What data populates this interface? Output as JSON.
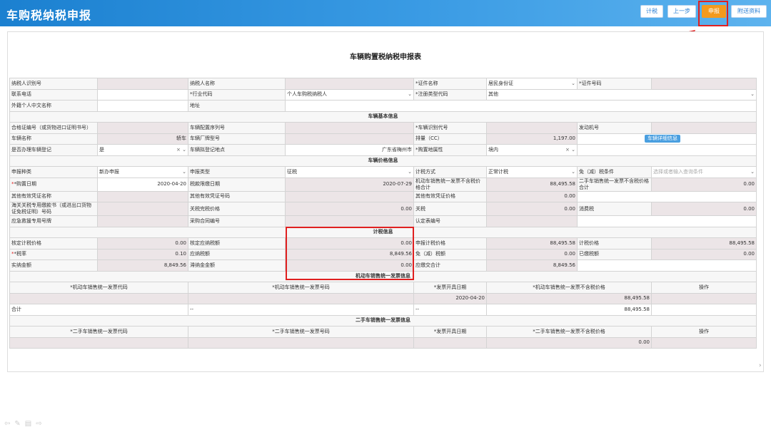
{
  "app_title": "车购税纳税申报",
  "toolbar": {
    "calc": "计税",
    "prev": "上一步",
    "submit": "申报",
    "attach": "附送资料"
  },
  "form_title": "车辆购置税纳税申报表",
  "r1": {
    "l1": "纳税人识别号",
    "l2": "纳税人名称",
    "l3": "*证件名称",
    "v3": "居民身份证",
    "l4": "*证件号码"
  },
  "r2": {
    "l1": "联系电话",
    "l2": "*行业代码",
    "v2": "个人车购税纳税人",
    "l3": "*注册类型代码",
    "v3": "其他"
  },
  "r3": {
    "l1": "外籍个人中文名称",
    "l2": "地址"
  },
  "s1": "车辆基本信息",
  "r4": {
    "l1": "合格证编号（或货物进口证明书号）",
    "l2": "车辆配置序列号",
    "l3": "*车辆识别代号",
    "l4": "发动机号"
  },
  "r5": {
    "l1": "车辆名称",
    "v1": "轿车",
    "l2": "车辆厂牌型号",
    "l3": "排量（CC）",
    "v3": "1,197.00",
    "btn": "车辆详细信息"
  },
  "r6": {
    "l1": "是否办理车辆登记",
    "v1": "是",
    "l2": "车辆拟登记地点",
    "v2": "广东省梅州市",
    "l3": "*购置地属性",
    "v3": "境内"
  },
  "s2": "车辆价格信息",
  "r7": {
    "l1": "申报种类",
    "v1": "新办申报",
    "l2": "申报类型",
    "v2": "征税",
    "l3": "计税方式",
    "v3": "正常计税",
    "l4": "免（减）税条件",
    "v4": "选择或者输入查询条件"
  },
  "r8": {
    "l1": "*购置日期",
    "v1": "2020-04-20",
    "l2": "税款限缴日期",
    "v2": "2020-07-29",
    "l3": "机动车销售统一发票不含税价格合计",
    "v3": "88,495.58",
    "l4": "二手车销售统一发票不含税价格合计",
    "v4": "0.00"
  },
  "r9": {
    "l1": "其他有效凭证名称",
    "l2": "其他有效凭证号码",
    "l3": "其他有效凭证价格",
    "v3": "0.00"
  },
  "r10": {
    "l1": "海关关税专用缴款书（或进出口货物证免税证明）号码",
    "l2": "关税完税价格",
    "v2": "0.00",
    "l3": "关税",
    "v3": "0.00",
    "l4": "消费税",
    "v4": "0.00"
  },
  "r11": {
    "l1": "应急救援专用号牌",
    "l2": "采购合同编号",
    "l3": "认定表编号"
  },
  "s3": "计税信息",
  "r12": {
    "l1": "核定计税价格",
    "v1": "0.00",
    "l2": "核定应纳税额",
    "v2": "0.00",
    "l3": "申报计税价格",
    "v3": "88,495.58",
    "l4": "计税价格",
    "v4": "88,495.58"
  },
  "r13": {
    "l1": "*税率",
    "v1": "0.10",
    "l2": "应纳税额",
    "v2": "8,849.56",
    "l3": "免（减）税额",
    "v3": "0.00",
    "l4": "已缴税额",
    "v4": "0.00"
  },
  "r14": {
    "l1": "实纳金额",
    "v1": "8,849.56",
    "l2": "滞纳金金额",
    "v2": "0.00",
    "l3": "应缴交合计",
    "v3": "8,849.56"
  },
  "s4": "机动车销售统一发票信息",
  "inv1": {
    "h1": "*机动车销售统一发票代码",
    "h2": "*机动车销售统一发票号码",
    "h3": "*发票开具日期",
    "h4": "*机动车销售统一发票不含税价格",
    "h5": "操作",
    "date": "2020-04-20",
    "amount": "88,495.58",
    "total_label": "合计",
    "dash": "--",
    "total": "88,495.58"
  },
  "s5": "二手车销售统一发票信息",
  "inv2": {
    "h1": "*二手车销售统一发票代码",
    "h2": "*二手车销售统一发票号码",
    "h3": "*发票开具日期",
    "h4": "*二手车销售统一发票不含税价格",
    "h5": "操作",
    "amount": "0.00"
  },
  "icons": {
    "arrow": "red-arrow-icon",
    "dropdown": "chevron-down-icon",
    "clear": "close-icon"
  },
  "colors": {
    "header": "#1b80d0",
    "submit": "#f39a1e",
    "highlight": "#e02020"
  }
}
